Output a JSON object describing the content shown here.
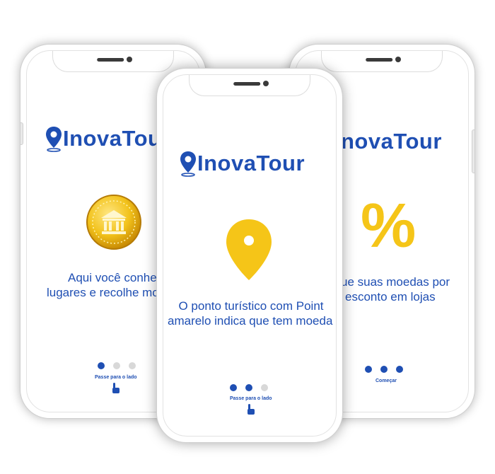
{
  "brand": {
    "name": "InovaTour",
    "color": "#1f4fb3",
    "accent": "#f5c518"
  },
  "screens": [
    {
      "id": "left",
      "logo_text": "InovaTour",
      "icon": "gold-coin-icon",
      "text_line1": "Aqui você conhec",
      "text_line2": "lugares e recolhe mo",
      "dots_active": [
        true,
        false,
        false
      ],
      "hint": "Passe para o lado",
      "hint_icon": "swipe-hand-icon"
    },
    {
      "id": "center",
      "logo_text": "InovaTour",
      "icon": "yellow-map-pin-icon",
      "text_line1": "O ponto turístico com Point",
      "text_line2": "amarelo indica que tem moeda",
      "dots_active": [
        true,
        true,
        false
      ],
      "hint": "Passe para o lado",
      "hint_icon": "swipe-hand-icon"
    },
    {
      "id": "right",
      "logo_text": "novaTour",
      "icon": "percent-icon",
      "text_line1": "ue suas moedas por",
      "text_line2": "esconto em lojas",
      "dots_active": [
        true,
        true,
        true
      ],
      "hint": "Começar"
    }
  ]
}
